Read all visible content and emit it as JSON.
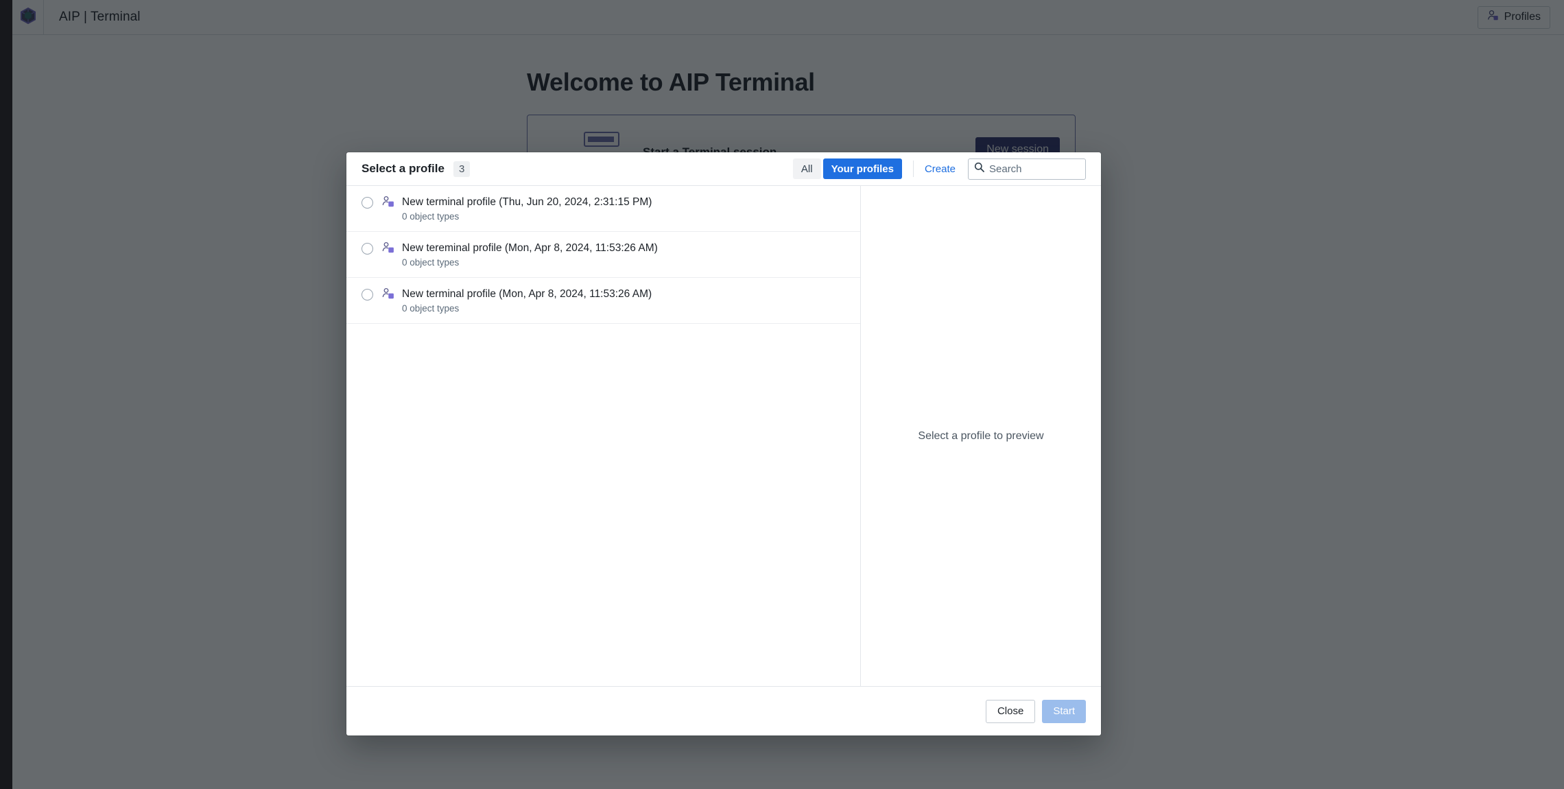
{
  "topbar": {
    "logo_icon": "ontology-cube-icon",
    "app_title": "AIP | Terminal",
    "profiles_button": {
      "label": "Profiles",
      "icon": "profile-person-icon"
    }
  },
  "background": {
    "heading": "Welcome to AIP Terminal",
    "card": {
      "title": "Start a Terminal session",
      "illustration_icon": "terminal-illustration",
      "new_session_label": "New session"
    }
  },
  "modal": {
    "title": "Select a profile",
    "count_badge": "3",
    "tabs": [
      {
        "label": "All",
        "active": false
      },
      {
        "label": "Your profiles",
        "active": true
      }
    ],
    "create_link": "Create",
    "search": {
      "icon": "search-icon",
      "placeholder": "Search",
      "value": ""
    },
    "profiles": [
      {
        "icon": "profile-object-icon",
        "name": "New terminal profile (Thu, Jun 20, 2024, 2:31:15 PM)",
        "object_types": "0 object types",
        "selected": false
      },
      {
        "icon": "profile-object-icon",
        "name": "New tereminal profile (Mon, Apr 8, 2024, 11:53:26 AM)",
        "object_types": "0 object types",
        "selected": false
      },
      {
        "icon": "profile-object-icon",
        "name": "New terminal profile (Mon, Apr 8, 2024, 11:53:26 AM)",
        "object_types": "0 object types",
        "selected": false
      }
    ],
    "preview_empty_text": "Select a profile to preview",
    "footer": {
      "close_label": "Close",
      "start_label": "Start",
      "start_disabled": true
    }
  },
  "colors": {
    "accent_blue": "#1f6fe0",
    "brand_purple": "#2d2f6e",
    "icon_purple": "#7b6fd6",
    "start_disabled": "#9bbdec",
    "overlay": "rgba(16,22,26,0.64)"
  }
}
